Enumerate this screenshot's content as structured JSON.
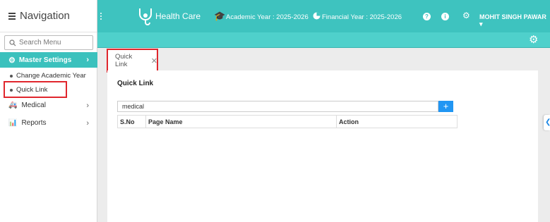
{
  "sidebar": {
    "title": "Navigation",
    "search_placeholder": "Search Menu",
    "items": [
      {
        "label": "Master Settings",
        "icon": "gear-icon"
      },
      {
        "label": "Medical",
        "icon": "ambulance-icon"
      },
      {
        "label": "Reports",
        "icon": "bar-chart-icon"
      }
    ],
    "subitems": [
      {
        "label": "Change Academic Year"
      },
      {
        "label": "Quick Link"
      }
    ]
  },
  "header": {
    "brand": "Health Care",
    "academic_year": "Academic Year : 2025-2026",
    "financial_year": "Financial Year : 2025-2026",
    "user": "MOHIT SINGH PAWAR",
    "help_icon": "?",
    "info_icon": "i"
  },
  "tab": {
    "label": "Quick Link"
  },
  "content": {
    "title": "Quick Link",
    "search_value": "medical",
    "add_label": "+",
    "columns": [
      "S.No",
      "Page Name",
      "Action"
    ]
  },
  "colors": {
    "accent": "#3ec3bf",
    "active": "#3bc1bd",
    "button": "#2196f3",
    "highlight": "#e0262d"
  }
}
